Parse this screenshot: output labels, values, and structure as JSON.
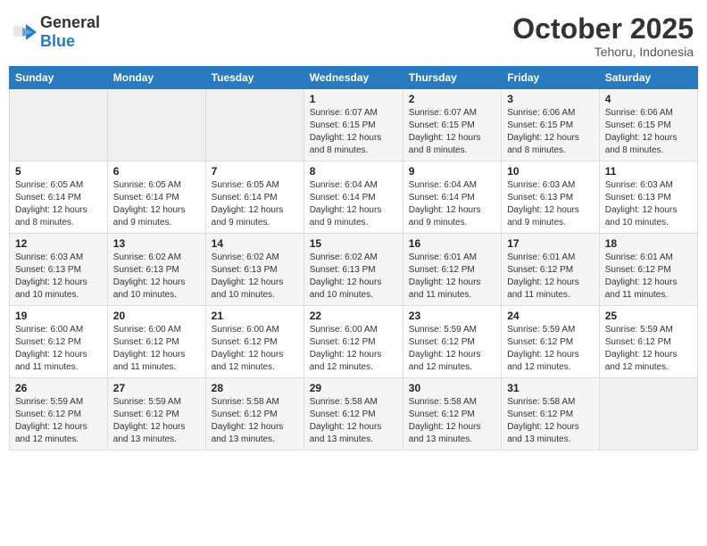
{
  "header": {
    "logo_general": "General",
    "logo_blue": "Blue",
    "month_title": "October 2025",
    "location": "Tehoru, Indonesia"
  },
  "weekdays": [
    "Sunday",
    "Monday",
    "Tuesday",
    "Wednesday",
    "Thursday",
    "Friday",
    "Saturday"
  ],
  "weeks": [
    [
      {
        "day": "",
        "info": ""
      },
      {
        "day": "",
        "info": ""
      },
      {
        "day": "",
        "info": ""
      },
      {
        "day": "1",
        "info": "Sunrise: 6:07 AM\nSunset: 6:15 PM\nDaylight: 12 hours and 8 minutes."
      },
      {
        "day": "2",
        "info": "Sunrise: 6:07 AM\nSunset: 6:15 PM\nDaylight: 12 hours and 8 minutes."
      },
      {
        "day": "3",
        "info": "Sunrise: 6:06 AM\nSunset: 6:15 PM\nDaylight: 12 hours and 8 minutes."
      },
      {
        "day": "4",
        "info": "Sunrise: 6:06 AM\nSunset: 6:15 PM\nDaylight: 12 hours and 8 minutes."
      }
    ],
    [
      {
        "day": "5",
        "info": "Sunrise: 6:05 AM\nSunset: 6:14 PM\nDaylight: 12 hours and 8 minutes."
      },
      {
        "day": "6",
        "info": "Sunrise: 6:05 AM\nSunset: 6:14 PM\nDaylight: 12 hours and 9 minutes."
      },
      {
        "day": "7",
        "info": "Sunrise: 6:05 AM\nSunset: 6:14 PM\nDaylight: 12 hours and 9 minutes."
      },
      {
        "day": "8",
        "info": "Sunrise: 6:04 AM\nSunset: 6:14 PM\nDaylight: 12 hours and 9 minutes."
      },
      {
        "day": "9",
        "info": "Sunrise: 6:04 AM\nSunset: 6:14 PM\nDaylight: 12 hours and 9 minutes."
      },
      {
        "day": "10",
        "info": "Sunrise: 6:03 AM\nSunset: 6:13 PM\nDaylight: 12 hours and 9 minutes."
      },
      {
        "day": "11",
        "info": "Sunrise: 6:03 AM\nSunset: 6:13 PM\nDaylight: 12 hours and 10 minutes."
      }
    ],
    [
      {
        "day": "12",
        "info": "Sunrise: 6:03 AM\nSunset: 6:13 PM\nDaylight: 12 hours and 10 minutes."
      },
      {
        "day": "13",
        "info": "Sunrise: 6:02 AM\nSunset: 6:13 PM\nDaylight: 12 hours and 10 minutes."
      },
      {
        "day": "14",
        "info": "Sunrise: 6:02 AM\nSunset: 6:13 PM\nDaylight: 12 hours and 10 minutes."
      },
      {
        "day": "15",
        "info": "Sunrise: 6:02 AM\nSunset: 6:13 PM\nDaylight: 12 hours and 10 minutes."
      },
      {
        "day": "16",
        "info": "Sunrise: 6:01 AM\nSunset: 6:12 PM\nDaylight: 12 hours and 11 minutes."
      },
      {
        "day": "17",
        "info": "Sunrise: 6:01 AM\nSunset: 6:12 PM\nDaylight: 12 hours and 11 minutes."
      },
      {
        "day": "18",
        "info": "Sunrise: 6:01 AM\nSunset: 6:12 PM\nDaylight: 12 hours and 11 minutes."
      }
    ],
    [
      {
        "day": "19",
        "info": "Sunrise: 6:00 AM\nSunset: 6:12 PM\nDaylight: 12 hours and 11 minutes."
      },
      {
        "day": "20",
        "info": "Sunrise: 6:00 AM\nSunset: 6:12 PM\nDaylight: 12 hours and 11 minutes."
      },
      {
        "day": "21",
        "info": "Sunrise: 6:00 AM\nSunset: 6:12 PM\nDaylight: 12 hours and 12 minutes."
      },
      {
        "day": "22",
        "info": "Sunrise: 6:00 AM\nSunset: 6:12 PM\nDaylight: 12 hours and 12 minutes."
      },
      {
        "day": "23",
        "info": "Sunrise: 5:59 AM\nSunset: 6:12 PM\nDaylight: 12 hours and 12 minutes."
      },
      {
        "day": "24",
        "info": "Sunrise: 5:59 AM\nSunset: 6:12 PM\nDaylight: 12 hours and 12 minutes."
      },
      {
        "day": "25",
        "info": "Sunrise: 5:59 AM\nSunset: 6:12 PM\nDaylight: 12 hours and 12 minutes."
      }
    ],
    [
      {
        "day": "26",
        "info": "Sunrise: 5:59 AM\nSunset: 6:12 PM\nDaylight: 12 hours and 12 minutes."
      },
      {
        "day": "27",
        "info": "Sunrise: 5:59 AM\nSunset: 6:12 PM\nDaylight: 12 hours and 13 minutes."
      },
      {
        "day": "28",
        "info": "Sunrise: 5:58 AM\nSunset: 6:12 PM\nDaylight: 12 hours and 13 minutes."
      },
      {
        "day": "29",
        "info": "Sunrise: 5:58 AM\nSunset: 6:12 PM\nDaylight: 12 hours and 13 minutes."
      },
      {
        "day": "30",
        "info": "Sunrise: 5:58 AM\nSunset: 6:12 PM\nDaylight: 12 hours and 13 minutes."
      },
      {
        "day": "31",
        "info": "Sunrise: 5:58 AM\nSunset: 6:12 PM\nDaylight: 12 hours and 13 minutes."
      },
      {
        "day": "",
        "info": ""
      }
    ]
  ]
}
